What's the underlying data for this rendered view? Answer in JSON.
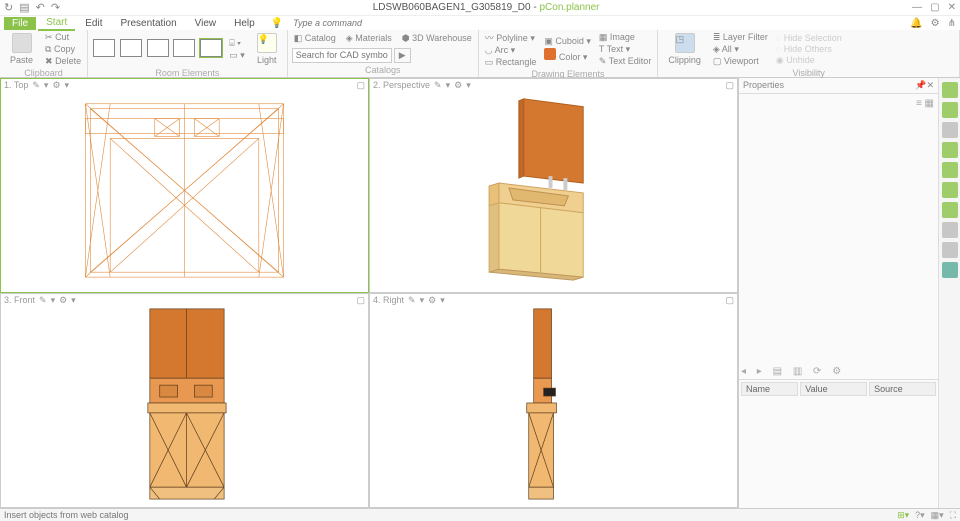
{
  "title": {
    "doc": "LDSWB060BAGEN1_G305819_D0",
    "app": "pCon.planner"
  },
  "menu": {
    "file": "File",
    "tabs": [
      "Start",
      "Edit",
      "Presentation",
      "View",
      "Help"
    ],
    "cmd_placeholder": "Type a command"
  },
  "ribbon": {
    "clipboard": {
      "label": "Clipboard",
      "paste": "Paste",
      "cut": "Cut",
      "copy": "Copy",
      "delete": "Delete"
    },
    "room": {
      "label": "Room Elements",
      "light": "Light"
    },
    "catalogs": {
      "label": "Catalogs",
      "catalog": "Catalog",
      "materials": "Materials",
      "warehouse": "3D Warehouse",
      "search_placeholder": "Search for CAD symbols"
    },
    "drawing": {
      "label": "Drawing Elements",
      "polyline": "Polyline",
      "arc": "Arc",
      "rectangle": "Rectangle",
      "cuboid": "Cuboid",
      "color": "Color",
      "image": "Image",
      "text": "Text",
      "texteditor": "Text Editor"
    },
    "visibility": {
      "label": "Visibility",
      "clipping": "Clipping",
      "layerfilter": "Layer Filter",
      "all": "All",
      "viewport": "Viewport",
      "hidesel": "Hide Selection",
      "hideoth": "Hide Others",
      "unhide": "Unhide"
    }
  },
  "views": {
    "v1": "1. Top",
    "v2": "2. Perspective",
    "v3": "3. Front",
    "v4": "4. Right"
  },
  "props": {
    "title": "Properties",
    "cols": {
      "name": "Name",
      "value": "Value",
      "source": "Source"
    }
  },
  "status": {
    "msg": "Insert objects from web catalog"
  },
  "colors": {
    "accent": "#8bc34a",
    "wood": "#e08a3c",
    "lightwood": "#f0c080"
  }
}
